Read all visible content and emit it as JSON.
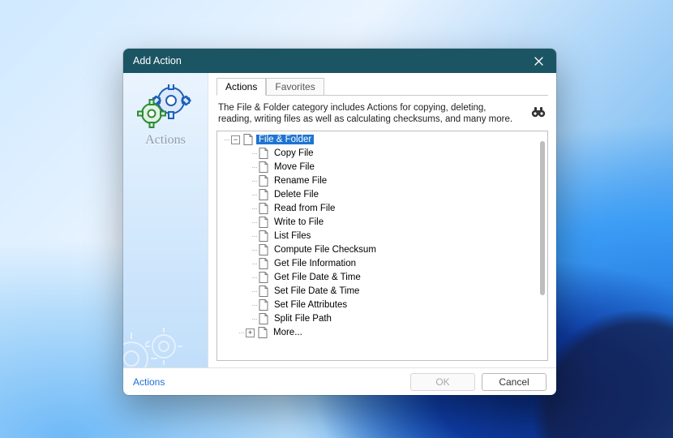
{
  "window": {
    "title": "Add Action"
  },
  "sidebar": {
    "caption": "Actions"
  },
  "tabs": [
    {
      "label": "Actions",
      "active": true
    },
    {
      "label": "Favorites",
      "active": false
    }
  ],
  "description": "The File & Folder category includes Actions for copying, deleting, reading, writing files as well as calculating checksums, and many more.",
  "tree": {
    "category": "File & Folder",
    "category_selected": true,
    "items": [
      "Copy File",
      "Move File",
      "Rename File",
      "Delete File",
      "Read from File",
      "Write to File",
      "List Files",
      "Compute File Checksum",
      "Get File Information",
      "Get File Date & Time",
      "Set File Date & Time",
      "Set File Attributes",
      "Split File Path"
    ],
    "more_label": "More..."
  },
  "footer": {
    "link": "Actions",
    "ok": "OK",
    "cancel": "Cancel"
  }
}
